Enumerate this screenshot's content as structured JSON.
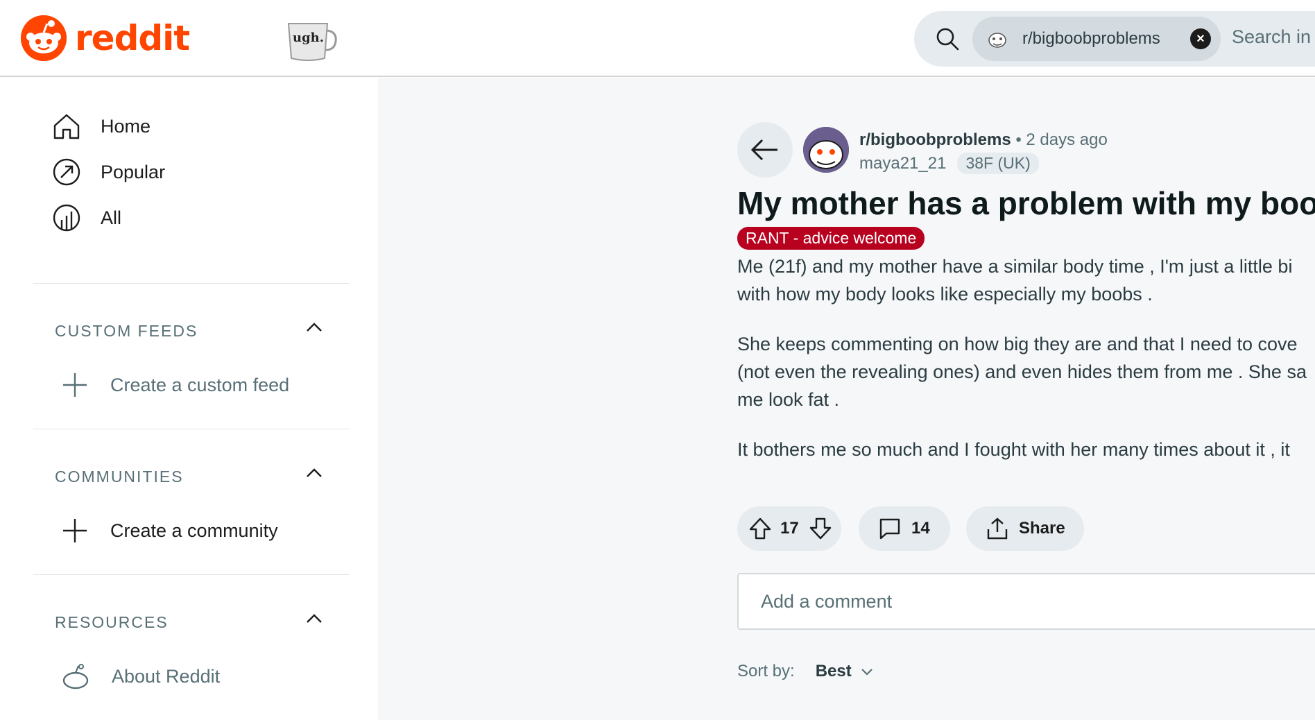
{
  "header": {
    "logo_text": "reddit",
    "mug_text": "ugh.",
    "search": {
      "chip_label": "r/bigboobproblems",
      "chip_close": "×",
      "placeholder": "Search in"
    }
  },
  "sidebar": {
    "nav": [
      {
        "label": "Home",
        "icon": "home-icon"
      },
      {
        "label": "Popular",
        "icon": "popular-icon"
      },
      {
        "label": "All",
        "icon": "all-icon"
      }
    ],
    "sections": [
      {
        "title": "CUSTOM FEEDS",
        "item": "Create a custom feed",
        "icon": "plus-icon"
      },
      {
        "title": "COMMUNITIES",
        "item": "Create a community",
        "icon": "plus-icon"
      },
      {
        "title": "RESOURCES",
        "item": "About Reddit",
        "icon": "reddit-alien-icon"
      }
    ]
  },
  "post": {
    "subreddit": "r/bigboobproblems",
    "time": "• 2 days ago",
    "username": "maya21_21",
    "user_flair": "38F (UK)",
    "title": "My mother has a problem with my boo",
    "flair": "RANT - advice welcome",
    "flair_color": "#b8001f",
    "body": [
      [
        "Me (21f) and my mother have a similar body time , I'm just a little bi",
        "with how my body looks like especially my boobs ."
      ],
      [
        "She keeps commenting on how big they are and that I need to cove",
        "(not even the revealing ones) and even hides them from me . She sa",
        "me look fat ."
      ],
      [
        "It bothers me so much and I fought with her many times about it , it"
      ]
    ],
    "votes": "17",
    "comments": "14",
    "share_label": "Share"
  },
  "comment_box": {
    "placeholder": "Add a comment"
  },
  "sort": {
    "label": "Sort by:",
    "value": "Best"
  },
  "colors": {
    "brand": "#ff4500",
    "flair": "#b8001f",
    "pill_bg": "#e5ebee"
  }
}
